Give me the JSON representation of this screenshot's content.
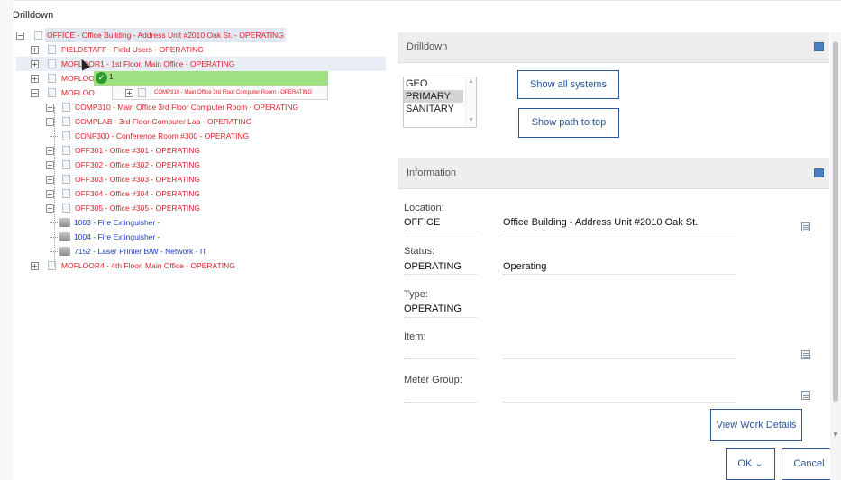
{
  "dialog": {
    "title": "Drilldown"
  },
  "tree": {
    "root": {
      "label": "OFFICE - Office Building - Address Unit #2010 Oak St. - OPERATING"
    },
    "items": [
      {
        "label": "FIELDSTAFF - Field Users - OPERATING"
      },
      {
        "label": "MOFLOOR1 - 1st Floor, Main Office - OPERATING"
      },
      {
        "label": "MOFLOO"
      },
      {
        "label": "MOFLOO"
      },
      {
        "label": "COMP310 - Main Office 3rd Floor Computer Room - OPERATING"
      },
      {
        "label": "COMPLAB - 3rd Floor Computer Lab - OPERATING"
      },
      {
        "label": "CONF300 - Conference Room #300 - OPERATING"
      },
      {
        "label": "OFF301 - Office #301 - OPERATING"
      },
      {
        "label": "OFF302 - Office #302 - OPERATING"
      },
      {
        "label": "OFF303 - Office #303 - OPERATING"
      },
      {
        "label": "OFF304 - Office #304 - OPERATING"
      },
      {
        "label": "OFF305 - Office #305 - OPERATING"
      },
      {
        "label": "1003 - Fire Extinguisher -"
      },
      {
        "label": "1004 - Fire Extinguisher -"
      },
      {
        "label": "7152 - Laser Printer B/W - Network - IT"
      },
      {
        "label": "MOFLOOR4 - 4th Floor, Main Office - OPERATING"
      }
    ],
    "drag": {
      "badge": "1",
      "label": "COMP310 - Main Office 3rd Floor Computer Room - OPERATING"
    }
  },
  "drilldown_section": {
    "title": "Drilldown",
    "systems": [
      "GEO",
      "PRIMARY",
      "SANITARY"
    ],
    "selected_system": "PRIMARY",
    "show_all_label": "Show all systems",
    "show_path_label": "Show path to top"
  },
  "information_section": {
    "title": "Information",
    "location_label": "Location:",
    "location_value": "OFFICE",
    "location_desc": "Office Building - Address Unit #2010 Oak St.",
    "status_label": "Status:",
    "status_value": "OPERATING",
    "status_desc": "Operating",
    "type_label": "Type:",
    "type_value": "OPERATING",
    "item_label": "Item:",
    "meter_group_label": "Meter Group:"
  },
  "footer": {
    "view_work_label": "View Work Details",
    "ok_label": "OK",
    "cancel_label": "Cancel"
  },
  "colors": {
    "accent": "#2b5797",
    "tree_location": "#d8232a",
    "tree_asset": "#1d3fb5",
    "drag_green": "#8edc6c"
  }
}
